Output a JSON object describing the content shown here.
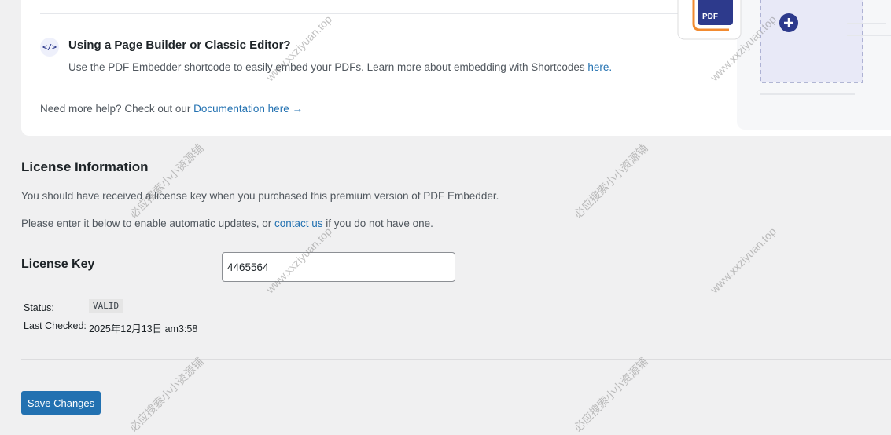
{
  "builder": {
    "icon": "code-icon",
    "title": "Using a Page Builder or Classic Editor?",
    "description": "Use the PDF Embedder shortcode to easily embed your PDFs. Learn more about embedding with Shortcodes ",
    "link_text": "here."
  },
  "help": {
    "text": "Need more help? Check out our ",
    "link_text": "Documentation here →"
  },
  "illustration": {
    "badge": "PDF"
  },
  "license": {
    "title": "License Information",
    "para1": "You should have received a license key when you purchased this premium version of PDF Embedder.",
    "para2_before": "Please enter it below to enable automatic updates, or ",
    "para2_link": "contact us",
    "para2_after": " if you do not have one.",
    "key_label": "License Key",
    "key_value": "4465564",
    "status_label": "Status:",
    "status_value": "VALID",
    "checked_label": "Last Checked:",
    "checked_value": "2025年12月13日 am3:58"
  },
  "actions": {
    "save_label": "Save Changes"
  },
  "watermarks": {
    "url": "www.xxziyuan.top",
    "cn": "必应搜索小小资源铺"
  },
  "colors": {
    "accent": "#2271b1",
    "illustration_navy": "#2d3a8c",
    "illustration_orange": "#f28b30"
  }
}
